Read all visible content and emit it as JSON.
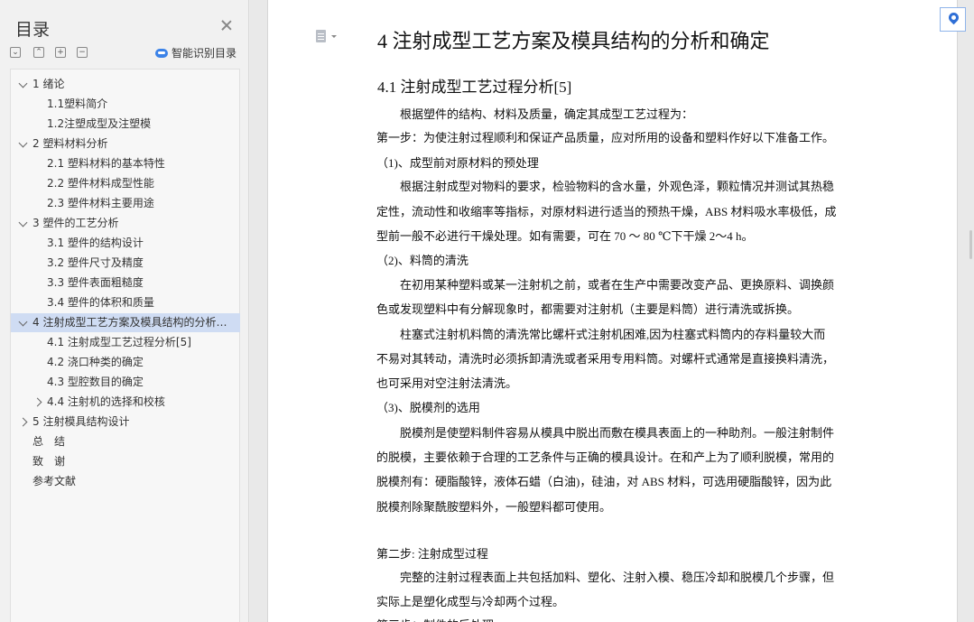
{
  "sidebar": {
    "title": "目录",
    "tools": [
      "⌄",
      "⌃",
      "+",
      "−"
    ],
    "smart_label": "智能识别目录",
    "toc": [
      {
        "label": "1 绪论",
        "level": 1,
        "expand": "down"
      },
      {
        "label": "1.1塑料简介",
        "level": 2
      },
      {
        "label": "1.2注塑成型及注塑模",
        "level": 2
      },
      {
        "label": "2 塑料材料分析",
        "level": 1,
        "expand": "down"
      },
      {
        "label": "2.1 塑料材料的基本特性",
        "level": 2
      },
      {
        "label": "2.2 塑件材料成型性能",
        "level": 2
      },
      {
        "label": "2.3 塑件材料主要用途",
        "level": 2
      },
      {
        "label": "3 塑件的工艺分析",
        "level": 1,
        "expand": "down"
      },
      {
        "label": "3.1 塑件的结构设计",
        "level": 2
      },
      {
        "label": "3.2 塑件尺寸及精度",
        "level": 2
      },
      {
        "label": "3.3 塑件表面粗糙度",
        "level": 2
      },
      {
        "label": "3.4 塑件的体积和质量",
        "level": 2
      },
      {
        "label": "4 注射成型工艺方案及模具结构的分析和确定",
        "level": 1,
        "expand": "down",
        "selected": true
      },
      {
        "label": "4.1 注射成型工艺过程分析[5]",
        "level": 2
      },
      {
        "label": "4.2 浇口种类的确定",
        "level": 2
      },
      {
        "label": "4.3 型腔数目的确定",
        "level": 2
      },
      {
        "label": "4.4 注射机的选择和校核",
        "level": 2,
        "expand": "right"
      },
      {
        "label": "5 注射模具结构设计",
        "level": 1,
        "expand": "right"
      },
      {
        "label": "总　结",
        "level": 1
      },
      {
        "label": "致　谢",
        "level": 1
      },
      {
        "label": "参考文献",
        "level": 1
      }
    ]
  },
  "document": {
    "heading1": "4 注射成型工艺方案及模具结构的分析和确定",
    "heading2": "4.1 注射成型工艺过程分析[5]",
    "lines": [
      "　　根据塑件的结构、材料及质量，确定其成型工艺过程为：",
      "第一步：为使注射过程顺利和保证产品质量，应对所用的设备和塑料作好以下准备工作。",
      "（1)、成型前对原材料的预处理",
      "　　根据注射成型对物料的要求，检验物料的含水量，外观色泽，颗粒情况并测试其热稳",
      "定性，流动性和收缩率等指标，对原材料进行适当的预热干燥，ABS 材料吸水率极低，成",
      "型前一般不必进行干燥处理。如有需要，可在 70 ～ 80 ℃下干燥 2～4 h。",
      "（2)、料筒的清洗",
      "　　在初用某种塑料或某一注射机之前，或者在生产中需要改变产品、更换原料、调换颜",
      "色或发现塑料中有分解现象时，都需要对注射机（主要是料筒）进行清洗或拆换。",
      "　　柱塞式注射机料筒的清洗常比螺杆式注射机困难,因为柱塞式料筒内的存料量较大而",
      "不易对其转动，清洗时必须拆卸清洗或者采用专用料筒。对螺杆式通常是直接换料清洗，",
      "也可采用对空注射法清洗。",
      "（3)、脱模剂的选用",
      "　　脱模剂是使塑料制件容易从模具中脱出而敷在模具表面上的一种助剂。一般注射制件",
      "的脱模，主要依赖于合理的工艺条件与正确的模具设计。在和产上为了顺利脱模，常用的",
      "脱模剂有：硬脂酸锌，液体石蜡（白油)，硅油，对 ABS 材料，可选用硬脂酸锌，因为此",
      "脱模剂除聚酰胺塑料外，一般塑料都可使用。",
      "",
      "第二步: 注射成型过程",
      "　　完整的注射过程表面上共包括加料、塑化、注射入模、稳压冷却和脱模几个步骤，但",
      "实际上是塑化成型与冷却两个过程。",
      "第三步：制件的后处理"
    ]
  }
}
